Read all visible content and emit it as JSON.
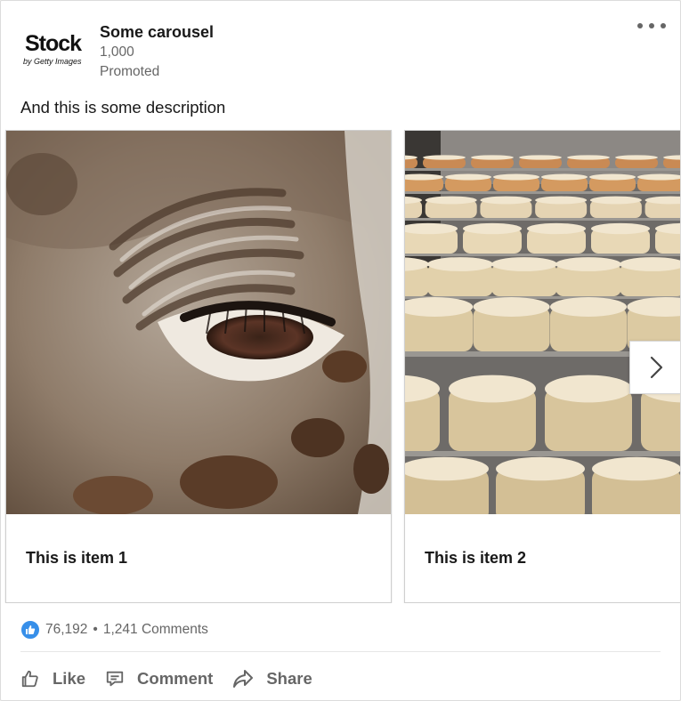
{
  "post": {
    "logo": {
      "text": "Stock",
      "subtext": "by Getty Images"
    },
    "actor_name": "Some carousel",
    "followers": "1,000",
    "promoted": "Promoted",
    "description": "And this is some description"
  },
  "carousel": {
    "items": [
      {
        "title": "This is item 1",
        "image": "giraffe-eye-photo"
      },
      {
        "title": "This is item 2",
        "image": "cheese-wheels-photo"
      }
    ],
    "next_icon": "chevron-right-icon"
  },
  "social": {
    "reaction_count": "76,192",
    "separator": "•",
    "comments_count": "1,241 Comments",
    "reaction_icon": "like-reaction-icon"
  },
  "actions": {
    "like_label": "Like",
    "comment_label": "Comment",
    "share_label": "Share"
  },
  "colors": {
    "like_blue": "#378fe9",
    "muted_text": "#666666",
    "primary_text": "#191919"
  }
}
